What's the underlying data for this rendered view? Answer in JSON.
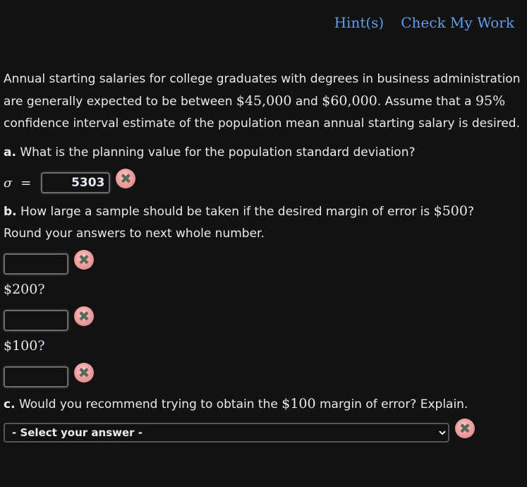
{
  "header": {
    "hints_label": "Hint(s)",
    "check_label": "Check My Work"
  },
  "intro": {
    "part1": "Annual starting salaries for college graduates with degrees in business administration are generally expected to be between ",
    "low": "$45,000",
    "and": " and ",
    "high": "$60,000",
    "part2": ". Assume that a ",
    "conf": "95%",
    "part3": " confidence interval estimate of the population mean annual starting salary is desired."
  },
  "part_a": {
    "label": "a.",
    "question": " What is the planning value for the population standard deviation?",
    "sigma_symbol": "σ",
    "equals": "=",
    "answer_value": "5303",
    "status_icon": "incorrect-x-icon"
  },
  "part_b": {
    "label": "b.",
    "question": " How large a sample should be taken if the desired margin of error is ",
    "margin1": "$500",
    "qmark": "?",
    "instruction": "Round your answers to next whole number.",
    "answers": [
      {
        "value": "",
        "margin": "$500"
      },
      {
        "value": "",
        "margin": "$200"
      },
      {
        "value": "",
        "margin": "$100"
      }
    ],
    "margin2_label": "$200",
    "margin3_label": "$100"
  },
  "part_c": {
    "label": "c.",
    "question_pre": " Would you recommend trying to obtain the ",
    "margin": "$100",
    "question_post": " margin of error? Explain.",
    "select_placeholder": "- Select your answer -"
  },
  "icons": {
    "incorrect": "✖"
  }
}
